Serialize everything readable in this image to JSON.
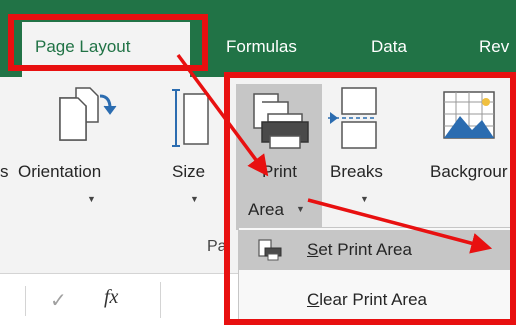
{
  "ribbon": {
    "tabs": [
      {
        "label": "Page Layout",
        "active": true
      },
      {
        "label": "Formulas",
        "active": false
      },
      {
        "label": "Data",
        "active": false
      },
      {
        "label": "Rev",
        "active": false
      }
    ],
    "commands": {
      "margins_partial": "s",
      "orientation": "Orientation",
      "size": "Size",
      "print_area_line1": "Print",
      "print_area_line2": "Area",
      "breaks": "Breaks",
      "background": "Backgrour"
    },
    "group_label": "Pa"
  },
  "dropdown": {
    "items": [
      {
        "access_key": "S",
        "rest": "et Print Area",
        "icon": "set-print-area-icon",
        "selected": true
      },
      {
        "access_key": "C",
        "rest": "lear Print Area",
        "icon": null,
        "selected": false
      }
    ]
  },
  "formula_bar": {
    "check": "✓",
    "fx": "fx"
  },
  "colors": {
    "ribbon_tab_green": "#217346",
    "annotation_red": "#e81010",
    "ribbon_bg": "#f3f3f3",
    "highlight_gray": "#c6c6c6"
  }
}
